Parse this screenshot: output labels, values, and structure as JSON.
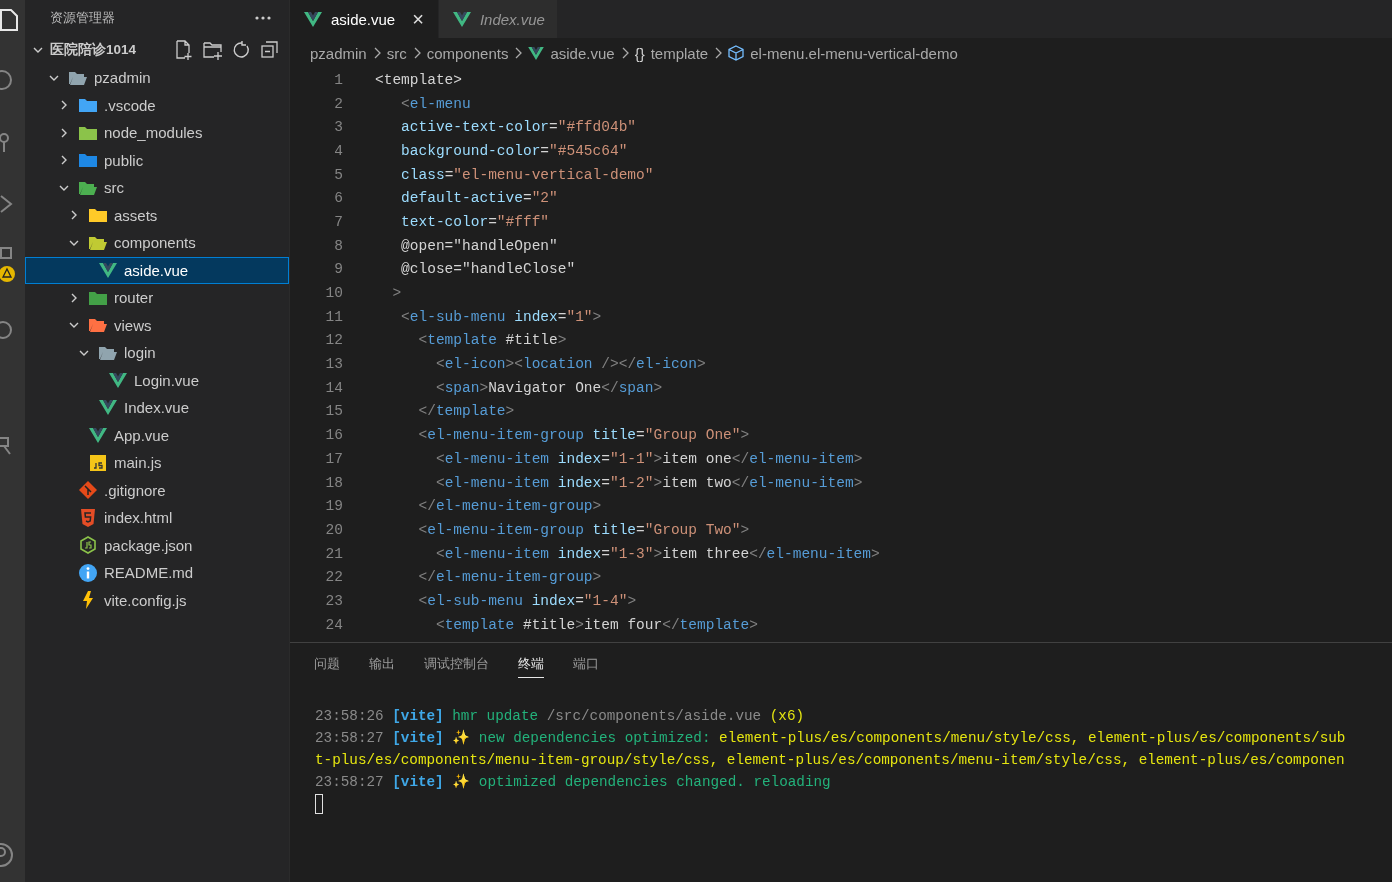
{
  "explorer": {
    "title": "资源管理器",
    "workspace": {
      "name": "医院陪诊1014",
      "expanded": true
    },
    "tree": [
      {
        "name": "pzadmin",
        "kind": "folder",
        "color": "#90a4ae",
        "expanded": true,
        "selected": false,
        "children": [
          {
            "name": ".vscode",
            "kind": "folder",
            "color": "#42a5f5",
            "expanded": false,
            "selected": false
          },
          {
            "name": "node_modules",
            "kind": "folder",
            "color": "#8bc34a",
            "expanded": false,
            "selected": false
          },
          {
            "name": "public",
            "kind": "folder",
            "color": "#1e88e5",
            "expanded": false,
            "selected": false
          },
          {
            "name": "src",
            "kind": "folder",
            "color": "#4caf50",
            "expanded": true,
            "selected": false,
            "children": [
              {
                "name": "assets",
                "kind": "folder",
                "color": "#ffca28",
                "expanded": false,
                "selected": false
              },
              {
                "name": "components",
                "kind": "folder",
                "color": "#c0ca33",
                "expanded": true,
                "selected": false,
                "children": [
                  {
                    "name": "aside.vue",
                    "kind": "vue",
                    "selected": true
                  }
                ]
              },
              {
                "name": "router",
                "kind": "folder",
                "color": "#43a047",
                "expanded": false,
                "selected": false
              },
              {
                "name": "views",
                "kind": "folder",
                "color": "#ff7043",
                "expanded": true,
                "selected": false,
                "children": [
                  {
                    "name": "login",
                    "kind": "folder",
                    "color": "#90a4ae",
                    "expanded": true,
                    "selected": false,
                    "children": [
                      {
                        "name": "Login.vue",
                        "kind": "vue",
                        "selected": false
                      }
                    ]
                  },
                  {
                    "name": "Index.vue",
                    "kind": "vue",
                    "selected": false
                  }
                ]
              },
              {
                "name": "App.vue",
                "kind": "vue",
                "selected": false
              },
              {
                "name": "main.js",
                "kind": "js",
                "selected": false
              }
            ]
          },
          {
            "name": ".gitignore",
            "kind": "git",
            "selected": false
          },
          {
            "name": "index.html",
            "kind": "html",
            "selected": false
          },
          {
            "name": "package.json",
            "kind": "json",
            "selected": false
          },
          {
            "name": "README.md",
            "kind": "info",
            "selected": false
          },
          {
            "name": "vite.config.js",
            "kind": "vite",
            "selected": false
          }
        ]
      }
    ]
  },
  "tabs": [
    {
      "label": "aside.vue",
      "selected": true,
      "preview": false,
      "close": "×"
    },
    {
      "label": "Index.vue",
      "selected": false,
      "preview": true
    }
  ],
  "breadcrumbs": [
    {
      "label": "pzadmin",
      "kind": "plain"
    },
    {
      "label": "src",
      "kind": "plain"
    },
    {
      "label": "components",
      "kind": "plain"
    },
    {
      "label": "aside.vue",
      "kind": "vue"
    },
    {
      "label": "template",
      "kind": "glyph",
      "glyph": "{}"
    },
    {
      "label": "el-menu.el-menu-vertical-demo",
      "kind": "element"
    }
  ],
  "code": [
    {
      "n": "1",
      "t": [
        {
          "kind": "txt",
          "text": "<template>"
        }
      ]
    },
    {
      "n": "2",
      "t": [
        {
          "kind": "p",
          "text": "   <"
        },
        {
          "kind": "tag",
          "text": "el-menu"
        }
      ]
    },
    {
      "n": "3",
      "t": [
        {
          "kind": "attr",
          "text": "   active-text-color"
        },
        {
          "kind": "txt",
          "text": "="
        },
        {
          "kind": "str",
          "text": "\"#ffd04b\""
        }
      ]
    },
    {
      "n": "4",
      "t": [
        {
          "kind": "attr",
          "text": "   background-color"
        },
        {
          "kind": "txt",
          "text": "="
        },
        {
          "kind": "str",
          "text": "\"#545c64\""
        }
      ]
    },
    {
      "n": "5",
      "t": [
        {
          "kind": "attr",
          "text": "   class"
        },
        {
          "kind": "txt",
          "text": "="
        },
        {
          "kind": "str",
          "text": "\"el-menu-vertical-demo\""
        }
      ]
    },
    {
      "n": "6",
      "t": [
        {
          "kind": "attr",
          "text": "   default-active"
        },
        {
          "kind": "txt",
          "text": "="
        },
        {
          "kind": "str",
          "text": "\"2\""
        }
      ]
    },
    {
      "n": "7",
      "t": [
        {
          "kind": "attr",
          "text": "   text-color"
        },
        {
          "kind": "txt",
          "text": "="
        },
        {
          "kind": "str",
          "text": "\"#fff\""
        }
      ]
    },
    {
      "n": "8",
      "t": [
        {
          "kind": "txt",
          "text": "   @open=\"handleOpen\""
        }
      ]
    },
    {
      "n": "9",
      "t": [
        {
          "kind": "txt",
          "text": "   @close=\"handleClose\""
        }
      ]
    },
    {
      "n": "10",
      "t": [
        {
          "kind": "p",
          "text": "  >"
        }
      ]
    },
    {
      "n": "11",
      "t": [
        {
          "kind": "p",
          "text": "   <"
        },
        {
          "kind": "tag",
          "text": "el-sub-menu"
        },
        {
          "kind": "attr",
          "text": " index"
        },
        {
          "kind": "txt",
          "text": "="
        },
        {
          "kind": "str",
          "text": "\"1\""
        },
        {
          "kind": "p",
          "text": ">"
        }
      ]
    },
    {
      "n": "12",
      "t": [
        {
          "kind": "p",
          "text": "     <"
        },
        {
          "kind": "tag",
          "text": "template"
        },
        {
          "kind": "txt",
          "text": " #title"
        },
        {
          "kind": "p",
          "text": ">"
        }
      ]
    },
    {
      "n": "13",
      "t": [
        {
          "kind": "p",
          "text": "       <"
        },
        {
          "kind": "tag",
          "text": "el-icon"
        },
        {
          "kind": "p",
          "text": "><"
        },
        {
          "kind": "tag",
          "text": "location"
        },
        {
          "kind": "p",
          "text": " /></"
        },
        {
          "kind": "tag",
          "text": "el-icon"
        },
        {
          "kind": "p",
          "text": ">"
        }
      ]
    },
    {
      "n": "14",
      "t": [
        {
          "kind": "p",
          "text": "       <"
        },
        {
          "kind": "tag",
          "text": "span"
        },
        {
          "kind": "p",
          "text": ">"
        },
        {
          "kind": "txt",
          "text": "Navigator One"
        },
        {
          "kind": "p",
          "text": "</"
        },
        {
          "kind": "tag",
          "text": "span"
        },
        {
          "kind": "p",
          "text": ">"
        }
      ]
    },
    {
      "n": "15",
      "t": [
        {
          "kind": "p",
          "text": "     </"
        },
        {
          "kind": "tag",
          "text": "template"
        },
        {
          "kind": "p",
          "text": ">"
        }
      ]
    },
    {
      "n": "16",
      "t": [
        {
          "kind": "p",
          "text": "     <"
        },
        {
          "kind": "tag",
          "text": "el-menu-item-group"
        },
        {
          "kind": "attr",
          "text": " title"
        },
        {
          "kind": "txt",
          "text": "="
        },
        {
          "kind": "str",
          "text": "\"Group One\""
        },
        {
          "kind": "p",
          "text": ">"
        }
      ]
    },
    {
      "n": "17",
      "t": [
        {
          "kind": "p",
          "text": "       <"
        },
        {
          "kind": "tag",
          "text": "el-menu-item"
        },
        {
          "kind": "attr",
          "text": " index"
        },
        {
          "kind": "txt",
          "text": "="
        },
        {
          "kind": "str",
          "text": "\"1-1\""
        },
        {
          "kind": "p",
          "text": ">"
        },
        {
          "kind": "txt",
          "text": "item one"
        },
        {
          "kind": "p",
          "text": "</"
        },
        {
          "kind": "tag",
          "text": "el-menu-item"
        },
        {
          "kind": "p",
          "text": ">"
        }
      ]
    },
    {
      "n": "18",
      "t": [
        {
          "kind": "p",
          "text": "       <"
        },
        {
          "kind": "tag",
          "text": "el-menu-item"
        },
        {
          "kind": "attr",
          "text": " index"
        },
        {
          "kind": "txt",
          "text": "="
        },
        {
          "kind": "str",
          "text": "\"1-2\""
        },
        {
          "kind": "p",
          "text": ">"
        },
        {
          "kind": "txt",
          "text": "item two"
        },
        {
          "kind": "p",
          "text": "</"
        },
        {
          "kind": "tag",
          "text": "el-menu-item"
        },
        {
          "kind": "p",
          "text": ">"
        }
      ]
    },
    {
      "n": "19",
      "t": [
        {
          "kind": "p",
          "text": "     </"
        },
        {
          "kind": "tag",
          "text": "el-menu-item-group"
        },
        {
          "kind": "p",
          "text": ">"
        }
      ]
    },
    {
      "n": "20",
      "t": [
        {
          "kind": "p",
          "text": "     <"
        },
        {
          "kind": "tag",
          "text": "el-menu-item-group"
        },
        {
          "kind": "attr",
          "text": " title"
        },
        {
          "kind": "txt",
          "text": "="
        },
        {
          "kind": "str",
          "text": "\"Group Two\""
        },
        {
          "kind": "p",
          "text": ">"
        }
      ]
    },
    {
      "n": "21",
      "t": [
        {
          "kind": "p",
          "text": "       <"
        },
        {
          "kind": "tag",
          "text": "el-menu-item"
        },
        {
          "kind": "attr",
          "text": " index"
        },
        {
          "kind": "txt",
          "text": "="
        },
        {
          "kind": "str",
          "text": "\"1-3\""
        },
        {
          "kind": "p",
          "text": ">"
        },
        {
          "kind": "txt",
          "text": "item three"
        },
        {
          "kind": "p",
          "text": "</"
        },
        {
          "kind": "tag",
          "text": "el-menu-item"
        },
        {
          "kind": "p",
          "text": ">"
        }
      ]
    },
    {
      "n": "22",
      "t": [
        {
          "kind": "p",
          "text": "     </"
        },
        {
          "kind": "tag",
          "text": "el-menu-item-group"
        },
        {
          "kind": "p",
          "text": ">"
        }
      ]
    },
    {
      "n": "23",
      "t": [
        {
          "kind": "p",
          "text": "     <"
        },
        {
          "kind": "tag",
          "text": "el-sub-menu"
        },
        {
          "kind": "attr",
          "text": " index"
        },
        {
          "kind": "txt",
          "text": "="
        },
        {
          "kind": "str",
          "text": "\"1-4\""
        },
        {
          "kind": "p",
          "text": ">"
        }
      ]
    },
    {
      "n": "24",
      "t": [
        {
          "kind": "p",
          "text": "       <"
        },
        {
          "kind": "tag",
          "text": "template"
        },
        {
          "kind": "txt",
          "text": " #title"
        },
        {
          "kind": "p",
          "text": ">"
        },
        {
          "kind": "txt",
          "text": "item four"
        },
        {
          "kind": "p",
          "text": "</"
        },
        {
          "kind": "tag",
          "text": "template"
        },
        {
          "kind": "p",
          "text": ">"
        }
      ]
    }
  ],
  "panel": {
    "tabs": [
      {
        "label": "问题",
        "selected": false
      },
      {
        "label": "输出",
        "selected": false
      },
      {
        "label": "调试控制台",
        "selected": false
      },
      {
        "label": "终端",
        "selected": true
      },
      {
        "label": "端口",
        "selected": false
      }
    ],
    "terminal": [
      [
        {
          "kind": "time",
          "text": "23:58:26 "
        },
        {
          "kind": "tag",
          "text": "[vite]"
        },
        {
          "kind": "green",
          "text": " hmr update "
        },
        {
          "kind": "dim",
          "text": "/src/components/aside.vue"
        },
        {
          "kind": "yellow",
          "text": " (x6)"
        }
      ],
      [
        {
          "kind": "time",
          "text": "23:58:27 "
        },
        {
          "kind": "tag",
          "text": "[vite]"
        },
        {
          "kind": "green",
          "text": " ✨ new dependencies optimized: "
        },
        {
          "kind": "yellow",
          "text": "element-plus/es/components/menu/style/css, element-plus/es/components/sub"
        }
      ],
      [
        {
          "kind": "yellow",
          "text": "t-plus/es/components/menu-item-group/style/css, element-plus/es/components/menu-item/style/css, element-plus/es/componen"
        }
      ],
      [
        {
          "kind": "time",
          "text": "23:58:27 "
        },
        {
          "kind": "tag",
          "text": "[vite]"
        },
        {
          "kind": "green",
          "text": " ✨ optimized dependencies changed. reloading"
        }
      ]
    ]
  }
}
